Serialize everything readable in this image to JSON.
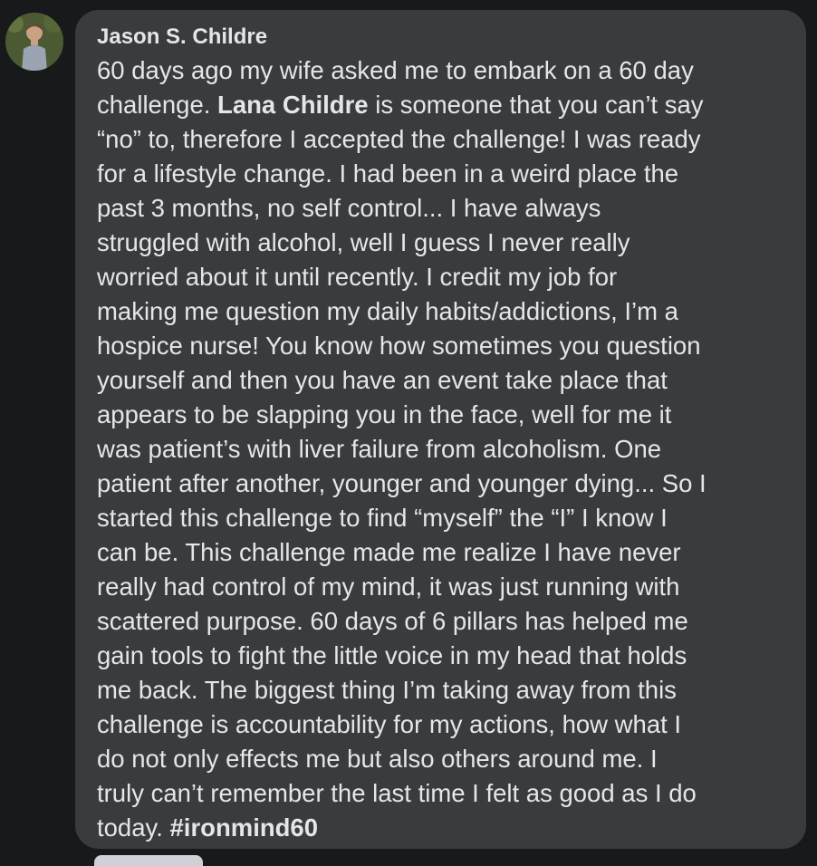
{
  "comment": {
    "author": "Jason S. Childre",
    "lines": [
      "60 days ago my wife asked me to embark on a 60 day",
      "is someone that you can’t say",
      "“no” to, therefore I accepted the challenge! I was ready",
      "for a lifestyle change. I had been in a weird place the",
      "past 3 months, no self control... I have always",
      "struggled with alcohol, well I guess I never really",
      "worried about it until recently. I credit my job for",
      "making me question my daily habits/addictions, I’m a",
      "hospice nurse! You know how sometimes you question",
      "yourself and then you have an event take place that",
      "appears to be slapping you in the face, well for me it",
      "was patient’s with liver failure from alcoholism. One",
      "patient after another, younger and younger dying... So I",
      "started this challenge to find “myself” the “I” I know I",
      "can be. This challenge made me realize I have never",
      "really had control of my mind, it was just running with",
      "scattered purpose. 60 days of 6 pillars has helped me",
      "gain tools to fight the little voice in my head that holds",
      "me back. The biggest thing I’m taking away from this",
      "challenge is accountability for my actions, how what I",
      "do not only effects me but also others around me. I",
      "truly can’t remember the last time I felt as good as I do",
      "today."
    ],
    "line2_prefix": "challenge.",
    "mention": "Lana Childre",
    "hashtag": "#ironmind60"
  }
}
